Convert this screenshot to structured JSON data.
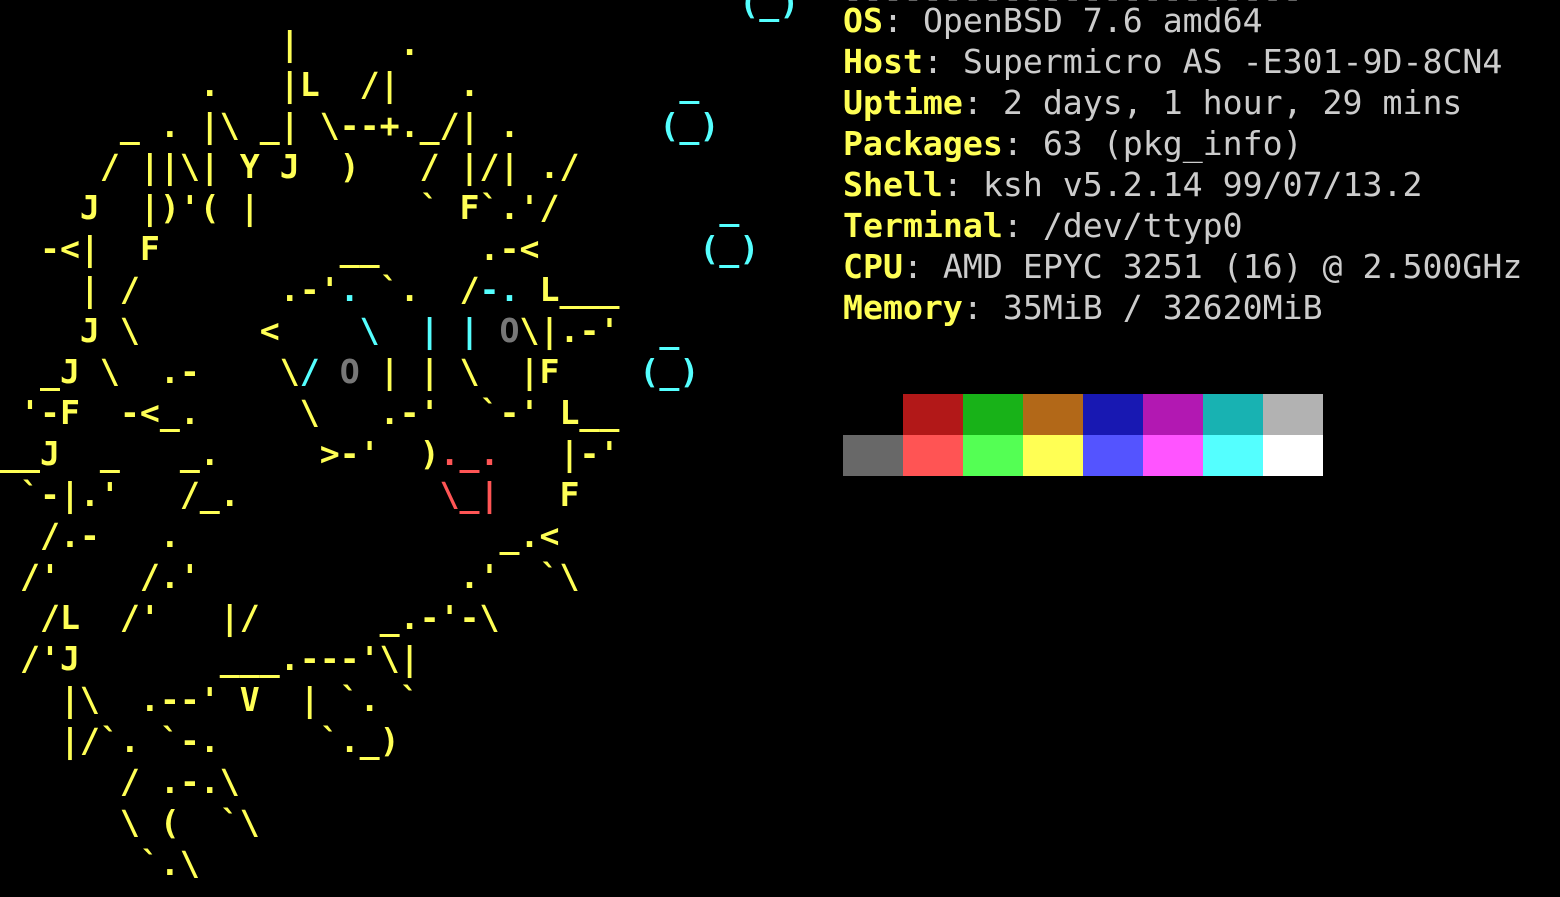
{
  "ascii_art": [
    [
      {
        "t": "                                     ",
        "c": "yellow"
      },
      {
        "t": "(_)",
        "c": "cyan"
      }
    ],
    [
      {
        "t": "              |     .",
        "c": "yellow"
      }
    ],
    [
      {
        "t": "          .   |L  /|   .          ",
        "c": "yellow"
      },
      {
        "t": "_",
        "c": "cyan"
      }
    ],
    [
      {
        "t": "      _ . |\\ _| \\--+._/| .       ",
        "c": "yellow"
      },
      {
        "t": "(_)",
        "c": "cyan"
      }
    ],
    [
      {
        "t": "     / ||\\| Y J  )   / |/| ./",
        "c": "yellow"
      }
    ],
    [
      {
        "t": "    J  |)'( |        ` F`.'/        ",
        "c": "yellow"
      },
      {
        "t": "_",
        "c": "cyan"
      }
    ],
    [
      {
        "t": "  -<|  F         __     .-<        ",
        "c": "yellow"
      },
      {
        "t": "(_)",
        "c": "cyan"
      }
    ],
    [
      {
        "t": "    | /       .-'",
        "c": "yellow"
      },
      {
        "t": ". ",
        "c": "cyan"
      },
      {
        "t": "`.  /",
        "c": "yellow"
      },
      {
        "t": "-. ",
        "c": "cyan"
      },
      {
        "t": "L___",
        "c": "yellow"
      }
    ],
    [
      {
        "t": "    J \\      <    ",
        "c": "yellow"
      },
      {
        "t": "\\  | | ",
        "c": "cyan"
      },
      {
        "t": "O",
        "c": "gray"
      },
      {
        "t": "\\|.-'  ",
        "c": "yellow"
      },
      {
        "t": "_",
        "c": "cyan"
      }
    ],
    [
      {
        "t": "  _J \\  .-    \\",
        "c": "yellow"
      },
      {
        "t": "/ ",
        "c": "cyan"
      },
      {
        "t": "O",
        "c": "gray"
      },
      {
        "t": " | | \\  |F    ",
        "c": "yellow"
      },
      {
        "t": "(_)",
        "c": "cyan"
      }
    ],
    [
      {
        "t": " '-F  -<_.     \\   .-'  `-' L__",
        "c": "yellow"
      }
    ],
    [
      {
        "t": "__J  _   _.     >-'  )",
        "c": "yellow"
      },
      {
        "t": "._.",
        "c": "red"
      },
      {
        "t": "   |-'",
        "c": "yellow"
      }
    ],
    [
      {
        "t": " `-|.'   /_.          ",
        "c": "yellow"
      },
      {
        "t": "\\_|",
        "c": "red"
      },
      {
        "t": "   F",
        "c": "yellow"
      }
    ],
    [
      {
        "t": "  /.-   .                _.<",
        "c": "yellow"
      }
    ],
    [
      {
        "t": " /'    /.'             .'  `\\",
        "c": "yellow"
      }
    ],
    [
      {
        "t": "  /L  /'   |/      _.-'-\\",
        "c": "yellow"
      }
    ],
    [
      {
        "t": " /'J       ___.---'\\|",
        "c": "yellow"
      }
    ],
    [
      {
        "t": "   |\\  .--' V  | `. `",
        "c": "yellow"
      }
    ],
    [
      {
        "t": "   |/`. `-.     `._)",
        "c": "yellow"
      }
    ],
    [
      {
        "t": "      / .-.\\",
        "c": "yellow"
      }
    ],
    [
      {
        "t": "      \\ (  `\\",
        "c": "yellow"
      }
    ],
    [
      {
        "t": "       `.\\",
        "c": "yellow"
      }
    ]
  ],
  "separator": "-----------------------",
  "info": [
    {
      "key": "OS",
      "value": "OpenBSD 7.6 amd64"
    },
    {
      "key": "Host",
      "value": "Supermicro AS -E301-9D-8CN4"
    },
    {
      "key": "Uptime",
      "value": "2 days, 1 hour, 29 mins"
    },
    {
      "key": "Packages",
      "value": "63 (pkg_info)"
    },
    {
      "key": "Shell",
      "value": "ksh v5.2.14 99/07/13.2"
    },
    {
      "key": "Terminal",
      "value": "/dev/ttyp0"
    },
    {
      "key": "CPU",
      "value": "AMD EPYC 3251 (16) @ 2.500GHz"
    },
    {
      "key": "Memory",
      "value": "35MiB / 32620MiB"
    }
  ],
  "palette": {
    "normal": [
      "#000000",
      "#b21818",
      "#18b218",
      "#b26818",
      "#1818b2",
      "#b218b2",
      "#18b2b2",
      "#b2b2b2"
    ],
    "bright": [
      "#686868",
      "#ff5454",
      "#54ff54",
      "#ffff54",
      "#5454ff",
      "#ff54ff",
      "#54ffff",
      "#ffffff"
    ]
  },
  "colors": {
    "background": "#000000",
    "key": "#ffff55",
    "value": "#cccccc",
    "art_yellow": "#ffff55",
    "art_cyan": "#55ffff",
    "art_red": "#ff5555",
    "art_gray": "#777777"
  }
}
